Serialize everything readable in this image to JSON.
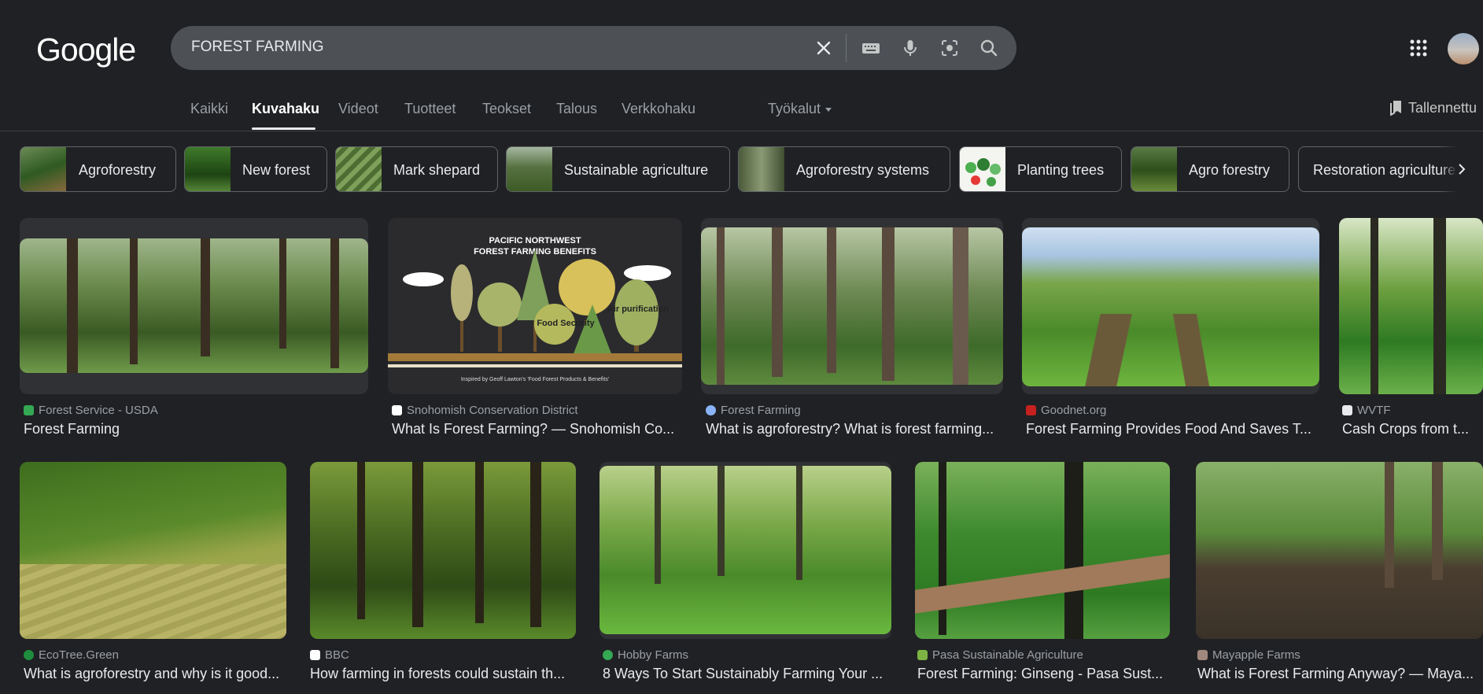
{
  "logo": "Google",
  "search": {
    "value": "FOREST FARMING"
  },
  "tabs": [
    {
      "label": "Kaikki"
    },
    {
      "label": "Kuvahaku",
      "active": true
    },
    {
      "label": "Videot"
    },
    {
      "label": "Tuotteet"
    },
    {
      "label": "Teokset"
    },
    {
      "label": "Talous"
    },
    {
      "label": "Verkkohaku"
    }
  ],
  "tools_label": "Työkalut",
  "saved_label": "Tallennettu",
  "chips": [
    {
      "label": "Agroforestry"
    },
    {
      "label": "New forest"
    },
    {
      "label": "Mark shepard"
    },
    {
      "label": "Sustainable agriculture"
    },
    {
      "label": "Agroforestry systems"
    },
    {
      "label": "Planting trees"
    },
    {
      "label": "Agro forestry"
    },
    {
      "label": "Restoration agriculture"
    }
  ],
  "results": [
    {
      "source": "Forest Service - USDA",
      "title": "Forest Farming",
      "favicon_color": "#34a853"
    },
    {
      "source": "Snohomish Conservation District",
      "title": "What Is Forest Farming? — Snohomish Co...",
      "favicon_color": "#ffffff"
    },
    {
      "source": "Forest Farming",
      "title": "What is agroforestry? What is forest farming...",
      "favicon_color": "#8ab4f8"
    },
    {
      "source": "Goodnet.org",
      "title": "Forest Farming Provides Food And Saves T...",
      "favicon_color": "#c5221f"
    },
    {
      "source": "WVTF",
      "title": "Cash Crops from t...",
      "favicon_color": "#e8eaed"
    },
    {
      "source": "EcoTree.Green",
      "title": "What is agroforestry and why is it good...",
      "favicon_color": "#1e8e3e"
    },
    {
      "source": "BBC",
      "title": "How farming in forests could sustain th...",
      "favicon_color": "#ffffff"
    },
    {
      "source": "Hobby Farms",
      "title": "8 Ways To Start Sustainably Farming Your ...",
      "favicon_color": "#34a853"
    },
    {
      "source": "Pasa Sustainable Agriculture",
      "title": "Forest Farming: Ginseng - Pasa Sust...",
      "favicon_color": "#7cb342"
    },
    {
      "source": "Mayapple Farms",
      "title": "What is Forest Farming Anyway? — Maya...",
      "favicon_color": "#a1887f"
    }
  ],
  "infographic": {
    "title_line1": "PACIFIC NORTHWEST",
    "title_line2": "FOREST FARMING BENEFITS",
    "label_food": "Food Security",
    "label_air": "Air purification",
    "caption": "Inspired by Geoff Lawton's 'Food Forest Products & Benefits'"
  }
}
